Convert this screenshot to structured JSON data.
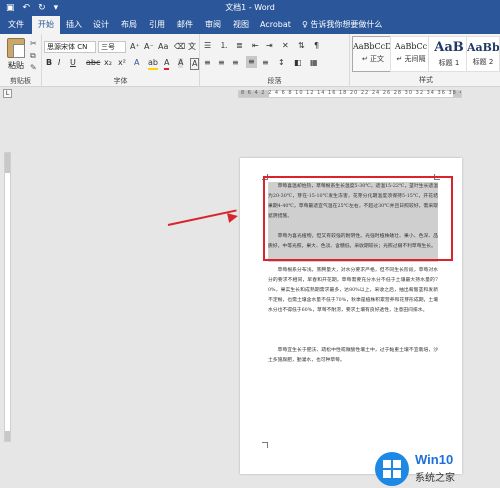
{
  "titlebar": {
    "title": "文档1 - Word",
    "save_icon": "save-icon",
    "undo_icon": "undo-icon",
    "redo_icon": "redo-icon"
  },
  "tabs": [
    "文件",
    "开始",
    "插入",
    "设计",
    "布局",
    "引用",
    "邮件",
    "审阅",
    "视图",
    "Acrobat"
  ],
  "active_tab": "开始",
  "tell_me": "告诉我你想要做什么",
  "ribbon": {
    "clipboard": {
      "paste_label": "粘贴",
      "group_label": "剪贴板"
    },
    "font": {
      "font_name": "思源宋体 CN",
      "font_size": "三号",
      "group_label": "字体",
      "buttons": [
        "B",
        "I",
        "U",
        "abc",
        "x₂",
        "x²",
        "A"
      ]
    },
    "paragraph": {
      "group_label": "段落"
    },
    "styles": {
      "group_label": "样式",
      "items": [
        {
          "sample": "AaBbCcDc",
          "name": "正文"
        },
        {
          "sample": "AaBbCc",
          "name": "无间隔"
        },
        {
          "sample": "AaB",
          "name": "标题 1"
        },
        {
          "sample": "AaBbC",
          "name": "标题 2"
        }
      ]
    }
  },
  "ruler": {
    "corner": "L",
    "numbers": "8  6  4  2     2  4  6  8  10  12  14  16  18  20  22  24  26  28  30  32  34  36  38  40  42  44  46  48"
  },
  "document": {
    "paragraphs": [
      "草莓喜温却怕热，草莓根系生长温度5-30℃，适温15-22℃，茎叶生长适温为20-30℃，芽在-15-10℃发生冻害，花芽分化期温度须保持5-15℃，开花结果期4-40℃，草莓最适宜气温在25℃左右，不超过30℃并且日照较好，需采取遮阴措施。",
      "草莓为喜光植物，但又有较强的耐阴性。光强时植株矮壮、果小、色深、品质好，中等光照，果大、色淡、含糖低，采收期较长；光照过弱不利草莓生长。",
      "草莓根系分布浅，蒸腾量大，对水分要求严格，但不同生长阶段，草莓对水分的要求不相同，早春和开花期，草莓需要充分水分不低于土壤最大持水量的70%，果实生长和成熟期需求最多，达80%以上，采收之后，抽出匍匐茎和发新不定根，也需土壤含水量不低于70%，秋季是植株积累营养和花芽形成期，土壤水分也不得低于60%，草莓不耐涝，要求土壤有良好透性，注意田间排水。",
      "草莓宜生长于肥沃、疏松中性或微酸性壤土中，过于黏重土壤不宜栽培，沙土多施腐肥，勤灌水，也可种草莓。"
    ]
  },
  "watermark": {
    "line1": "Win10",
    "line2": "系统之家"
  },
  "colors": {
    "accent": "#2b579a",
    "annotation": "#d9232d",
    "selection": "#cfcfcf"
  }
}
